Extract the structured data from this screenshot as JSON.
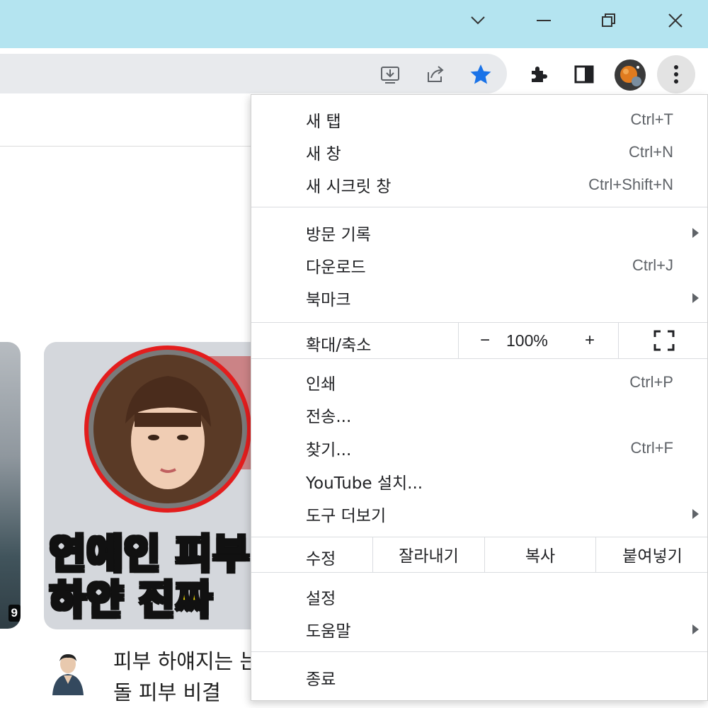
{
  "window": {
    "titlebar_color": "#b4e4f0",
    "controls": [
      "tab-search-chevron-icon",
      "minimize-icon",
      "restore-icon",
      "close-icon"
    ]
  },
  "toolbar": {
    "icons": [
      "install-app-icon",
      "share-icon",
      "bookmark-star-icon",
      "extensions-puzzle-icon",
      "side-panel-icon",
      "profile-avatar",
      "menu-kebab-icon"
    ],
    "star_color": "#1a73e8"
  },
  "page": {
    "left_thumb_duration": "9",
    "thumb_line1": "연예인 피부",
    "thumb_line2": "하얀 진짜",
    "video_title": "피부 하얘지는 는 아이돌 피부 비결"
  },
  "menu": {
    "group1": [
      {
        "label": "새 탭",
        "shortcut": "Ctrl+T"
      },
      {
        "label": "새 창",
        "shortcut": "Ctrl+N"
      },
      {
        "label": "새 시크릿 창",
        "shortcut": "Ctrl+Shift+N"
      }
    ],
    "group2": [
      {
        "label": "방문 기록",
        "shortcut": "",
        "submenu": true
      },
      {
        "label": "다운로드",
        "shortcut": "Ctrl+J",
        "submenu": false
      },
      {
        "label": "북마크",
        "shortcut": "",
        "submenu": true
      }
    ],
    "zoom": {
      "label": "확대/축소",
      "minus": "−",
      "value": "100%",
      "plus": "+"
    },
    "group3": [
      {
        "label": "인쇄",
        "shortcut": "Ctrl+P",
        "submenu": false
      },
      {
        "label": "전송...",
        "shortcut": "",
        "submenu": false
      },
      {
        "label": "찾기...",
        "shortcut": "Ctrl+F",
        "submenu": false
      },
      {
        "label": "YouTube 설치...",
        "shortcut": "",
        "submenu": false
      },
      {
        "label": "도구 더보기",
        "shortcut": "",
        "submenu": true
      }
    ],
    "edit": {
      "label": "수정",
      "cut": "잘라내기",
      "copy": "복사",
      "paste": "붙여넣기"
    },
    "group4": [
      {
        "label": "설정",
        "submenu": false
      },
      {
        "label": "도움말",
        "submenu": true
      }
    ],
    "exit": {
      "label": "종료"
    }
  }
}
